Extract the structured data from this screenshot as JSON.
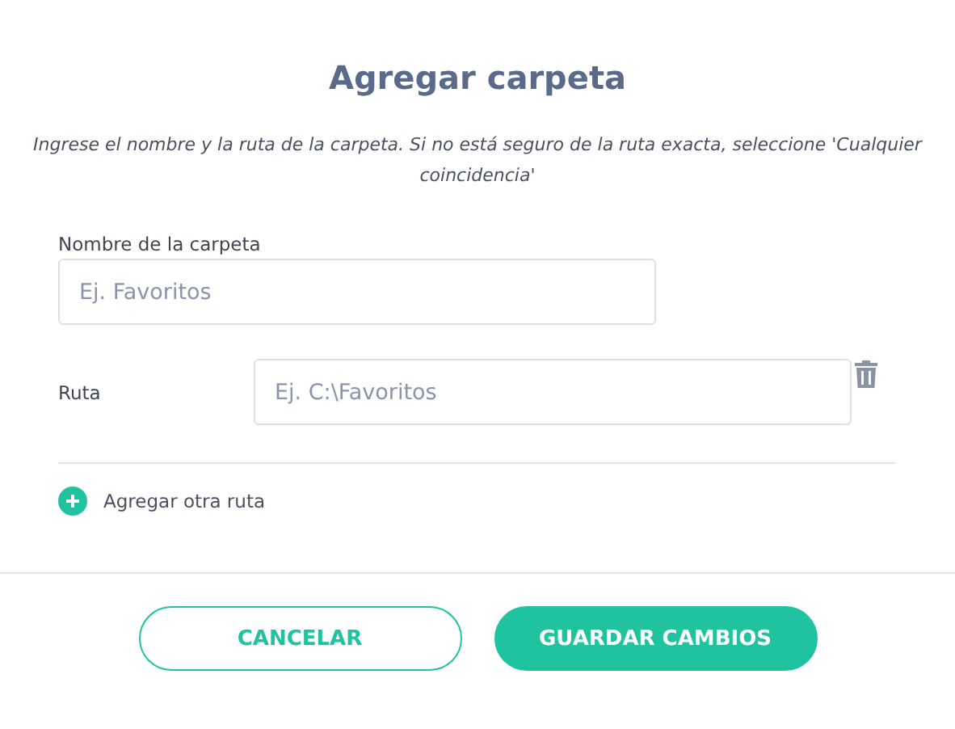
{
  "dialog": {
    "title": "Agregar carpeta",
    "description": "Ingrese el nombre y la ruta de la carpeta. Si no está seguro de la ruta exacta, seleccione 'Cualquier coincidencia'"
  },
  "folder_name": {
    "label": "Nombre de la carpeta",
    "placeholder": "Ej. Favoritos"
  },
  "paths": [
    {
      "label": "Ruta",
      "placeholder": "Ej. C:\\Favoritos"
    }
  ],
  "add_path": {
    "label": "Agregar otra ruta"
  },
  "buttons": [
    {
      "label": "CANCELAR",
      "kind": "secondary"
    },
    {
      "label": "GUARDAR CAMBIOS",
      "kind": "primary"
    }
  ]
}
